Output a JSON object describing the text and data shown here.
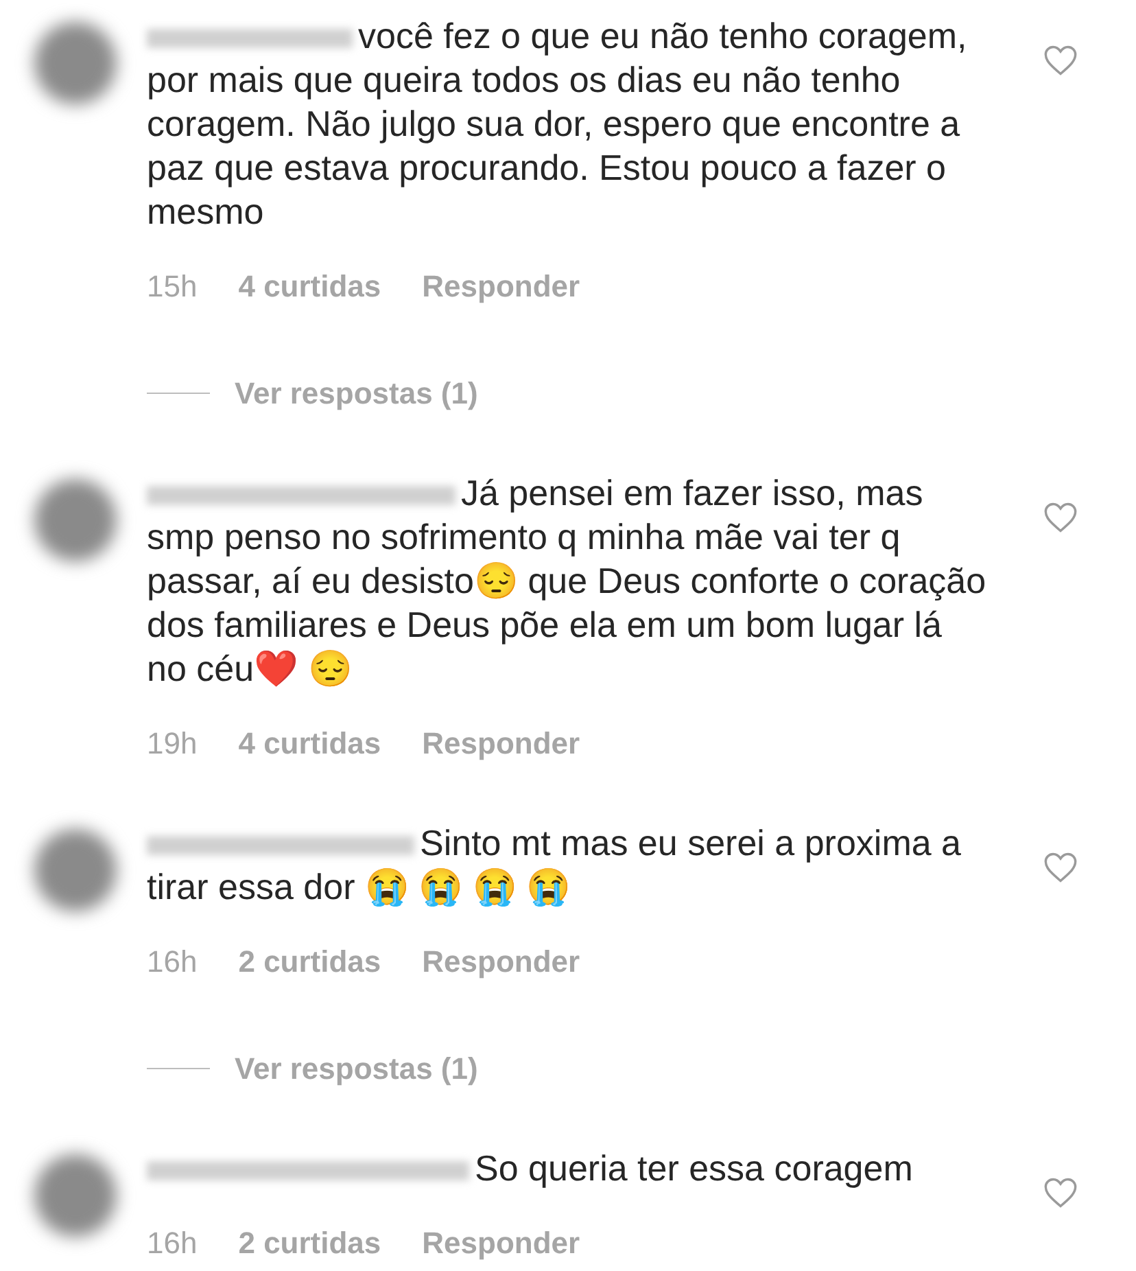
{
  "items": [
    {
      "kind": "comment",
      "text": "você fez o que eu não tenho coragem, por mais que queira todos os dias eu não tenho coragem. Não julgo sua dor, espero que encontre a paz que estava procurando. Estou pouco a fazer o mesmo",
      "time": "15h",
      "likes": "4 curtidas",
      "reply": "Responder"
    },
    {
      "kind": "replies",
      "label": "Ver respostas (1)"
    },
    {
      "kind": "comment",
      "text": "Já pensei em fazer isso, mas smp penso no sofrimento q minha mãe vai ter q passar, aí eu desisto😔 que Deus conforte o coração dos familiares e Deus põe ela em um bom lugar lá no céu❤️ 😔",
      "time": "19h",
      "likes": "4 curtidas",
      "reply": "Responder"
    },
    {
      "kind": "comment",
      "text": "Sinto mt mas eu serei a proxima a tirar essa dor 😭 😭 😭 😭",
      "time": "16h",
      "likes": "2 curtidas",
      "reply": "Responder"
    },
    {
      "kind": "replies",
      "label": "Ver respostas (1)"
    },
    {
      "kind": "comment",
      "text": "So queria ter essa coragem",
      "time": "16h",
      "likes": "2 curtidas",
      "reply": "Responder"
    }
  ]
}
